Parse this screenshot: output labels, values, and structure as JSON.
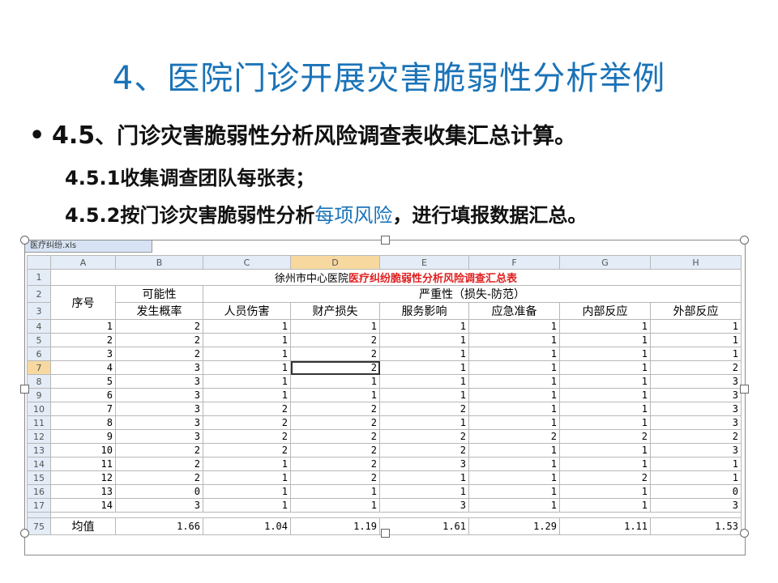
{
  "title": "4、医院门诊开展灾害脆弱性分析举例",
  "bullet": {
    "num": "4.5",
    "sep": "、",
    "text": "门诊灾害脆弱性分析风险调查表收集汇总计算。"
  },
  "sub1": "4.5.1收集调查团队每张表；",
  "sub2": {
    "pre": "4.5.2按门诊灾害脆弱性分析",
    "hl": "每项风险",
    "post": "，进行填报数据汇总。"
  },
  "sheet": {
    "tab_label": "医疗纠纷.xls",
    "columns": [
      "A",
      "B",
      "C",
      "D",
      "E",
      "F",
      "G",
      "H"
    ],
    "title_normal": "徐州市中心医院",
    "title_red": "医疗纠纷脆弱性分析风险调查汇总表",
    "header": {
      "seq": "序号",
      "possibility": "可能性",
      "prob": "发生概率",
      "severity": "严重性（损失-防范）",
      "sub": [
        "人员伤害",
        "财产损失",
        "服务影响",
        "应急准备",
        "内部反应",
        "外部反应"
      ]
    },
    "rows": [
      {
        "r": "4",
        "v": [
          "1",
          "2",
          "1",
          "1",
          "1",
          "1",
          "1",
          "1"
        ]
      },
      {
        "r": "5",
        "v": [
          "2",
          "2",
          "1",
          "2",
          "1",
          "1",
          "1",
          "1"
        ]
      },
      {
        "r": "6",
        "v": [
          "3",
          "2",
          "1",
          "2",
          "1",
          "1",
          "1",
          "1"
        ]
      },
      {
        "r": "7",
        "v": [
          "4",
          "3",
          "1",
          "2",
          "1",
          "1",
          "1",
          "2"
        ]
      },
      {
        "r": "8",
        "v": [
          "5",
          "3",
          "1",
          "1",
          "1",
          "1",
          "1",
          "3"
        ]
      },
      {
        "r": "9",
        "v": [
          "6",
          "3",
          "1",
          "1",
          "1",
          "1",
          "1",
          "3"
        ]
      },
      {
        "r": "10",
        "v": [
          "7",
          "3",
          "2",
          "2",
          "2",
          "1",
          "1",
          "3"
        ]
      },
      {
        "r": "11",
        "v": [
          "8",
          "3",
          "2",
          "2",
          "1",
          "1",
          "1",
          "3"
        ]
      },
      {
        "r": "12",
        "v": [
          "9",
          "3",
          "2",
          "2",
          "2",
          "2",
          "2",
          "2"
        ]
      },
      {
        "r": "13",
        "v": [
          "10",
          "2",
          "2",
          "2",
          "2",
          "1",
          "1",
          "3"
        ]
      },
      {
        "r": "14",
        "v": [
          "11",
          "2",
          "1",
          "2",
          "3",
          "1",
          "1",
          "1"
        ]
      },
      {
        "r": "15",
        "v": [
          "12",
          "2",
          "1",
          "2",
          "1",
          "1",
          "2",
          "1"
        ]
      },
      {
        "r": "16",
        "v": [
          "13",
          "0",
          "1",
          "1",
          "1",
          "1",
          "1",
          "0"
        ]
      },
      {
        "r": "17",
        "v": [
          "14",
          "3",
          "1",
          "1",
          "3",
          "1",
          "1",
          "3"
        ]
      }
    ],
    "avg_row": {
      "r": "75",
      "label": "均值",
      "v": [
        "1.66",
        "1.04",
        "1.19",
        "1.61",
        "1.29",
        "1.11",
        "1.53"
      ]
    }
  }
}
